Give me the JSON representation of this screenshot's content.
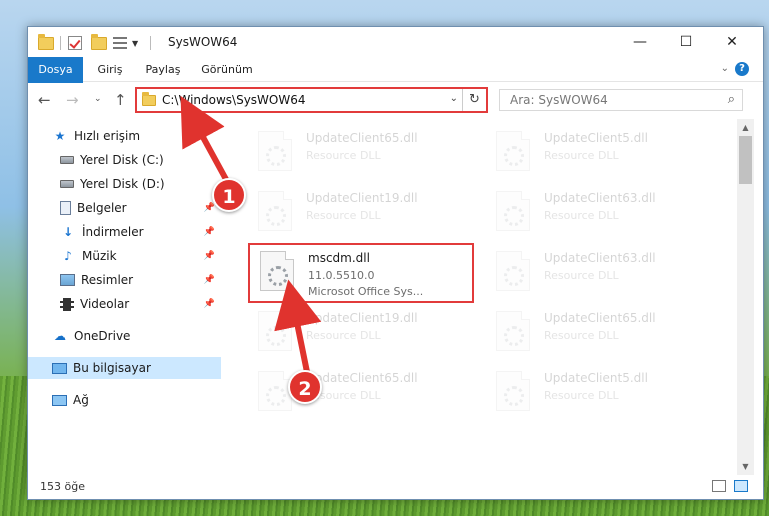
{
  "window": {
    "title": "SysWOW64",
    "controls": {
      "minimize": "—",
      "maximize": "☐",
      "close": "✕"
    }
  },
  "ribbon": {
    "tabs": [
      "Dosya",
      "Giriş",
      "Paylaş",
      "Görünüm"
    ]
  },
  "address": {
    "path": "C:\\Windows\\SysWOW64",
    "search_placeholder": "Ara: SysWOW64"
  },
  "nav": {
    "items": [
      {
        "label": "Hızlı erişim",
        "icon": "quick-access-star-icon"
      },
      {
        "label": "Yerel Disk (C:)",
        "icon": "drive-icon"
      },
      {
        "label": "Yerel Disk (D:)",
        "icon": "drive-icon"
      },
      {
        "label": "Belgeler",
        "icon": "documents-icon",
        "pinned": true
      },
      {
        "label": "İndirmeler",
        "icon": "downloads-icon",
        "pinned": true
      },
      {
        "label": "Müzik",
        "icon": "music-icon",
        "pinned": true
      },
      {
        "label": "Resimler",
        "icon": "pictures-icon",
        "pinned": true
      },
      {
        "label": "Videolar",
        "icon": "videos-icon",
        "pinned": true
      },
      {
        "label": "OneDrive",
        "icon": "onedrive-icon"
      },
      {
        "label": "Bu bilgisayar",
        "icon": "this-pc-icon",
        "selected": true
      },
      {
        "label": "Ağ",
        "icon": "network-icon"
      }
    ]
  },
  "files": [
    {
      "name": "UpdateClient65.dll",
      "type": "Resource DLL"
    },
    {
      "name": "UpdateClient5.dll",
      "type": "Resource DLL"
    },
    {
      "name": "UpdateClient19.dll",
      "type": "Resource DLL"
    },
    {
      "name": "UpdateClient63.dll",
      "type": "Resource DLL"
    },
    {
      "name": "mscdm.dll",
      "version": "11.0.5510.0",
      "type": "Microsot Office Sys..."
    },
    {
      "name": "UpdateClient63.dll",
      "type": "Resource DLL"
    },
    {
      "name": "UpdateClient19.dll",
      "type": "Resource DLL"
    },
    {
      "name": "UpdateClient65.dll",
      "type": "Resource DLL"
    },
    {
      "name": "UpdateClient65.dll",
      "type": "Resource DLL"
    },
    {
      "name": "UpdateClient5.dll",
      "type": "Resource DLL"
    }
  ],
  "status": {
    "count": "153 öğe"
  },
  "annotations": {
    "marker1": "1",
    "marker2": "2",
    "color": "#e0332e"
  }
}
